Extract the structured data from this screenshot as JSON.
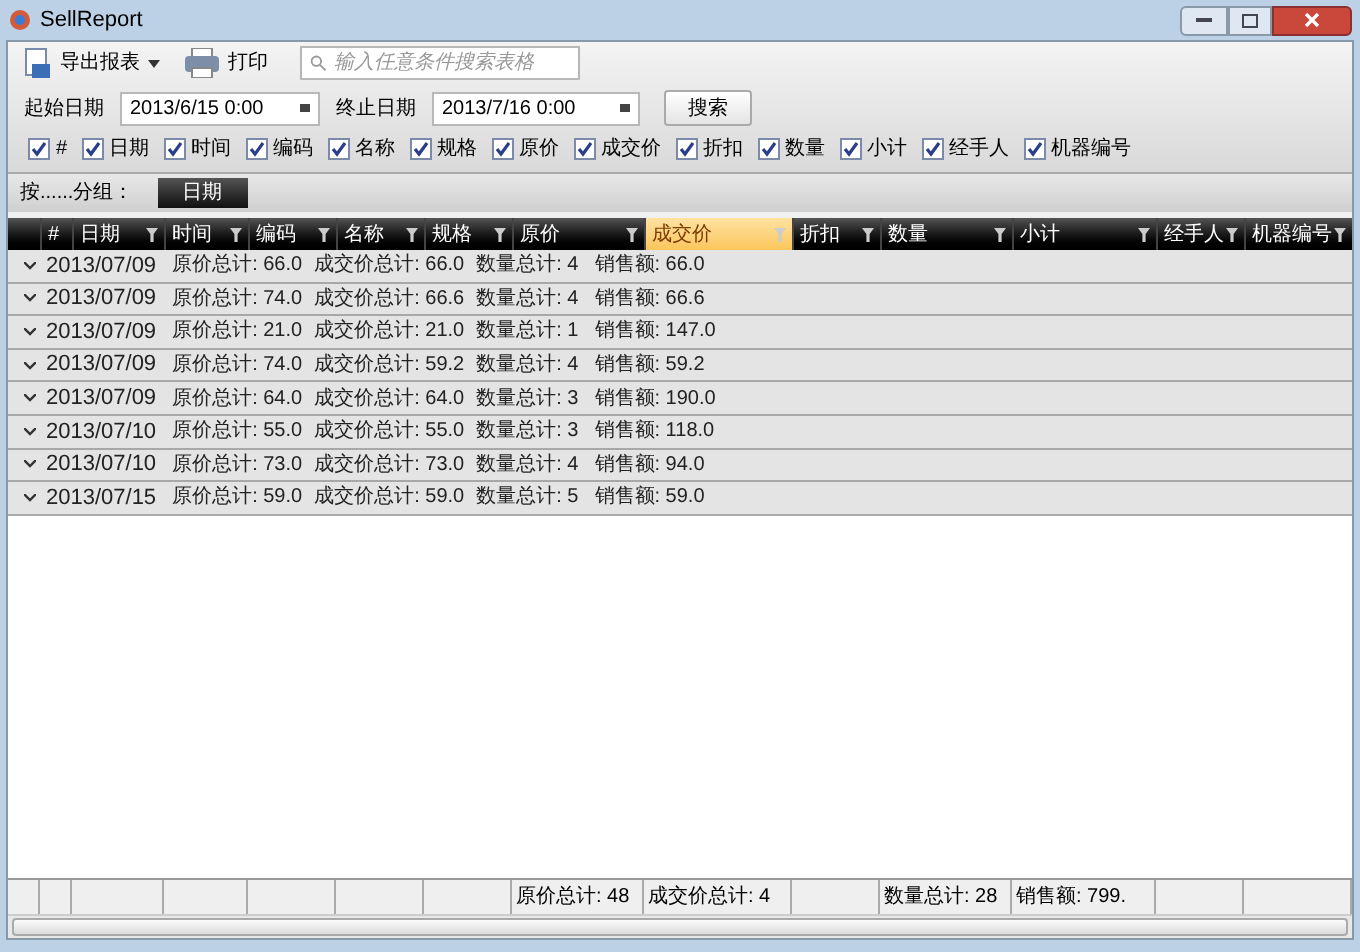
{
  "window": {
    "title": "SellReport"
  },
  "toolbar": {
    "export": "导出报表",
    "print": "打印",
    "search_placeholder": "输入任意条件搜索表格"
  },
  "filters": {
    "start_label": "起始日期",
    "start_value": "2013/6/15 0:00",
    "end_label": "终止日期",
    "end_value": "2013/7/16 0:00",
    "search_button": "搜索"
  },
  "column_toggles": [
    {
      "label": "#",
      "checked": true
    },
    {
      "label": "日期",
      "checked": true
    },
    {
      "label": "时间",
      "checked": true
    },
    {
      "label": "编码",
      "checked": true
    },
    {
      "label": "名称",
      "checked": true
    },
    {
      "label": "规格",
      "checked": true
    },
    {
      "label": "原价",
      "checked": true
    },
    {
      "label": "成交价",
      "checked": true
    },
    {
      "label": "折扣",
      "checked": true
    },
    {
      "label": "数量",
      "checked": true
    },
    {
      "label": "小计",
      "checked": true
    },
    {
      "label": "经手人",
      "checked": true
    },
    {
      "label": "机器编号",
      "checked": true
    }
  ],
  "grouping": {
    "label": "按......分组：",
    "groups": [
      "日期"
    ]
  },
  "table": {
    "columns": [
      {
        "label": "#",
        "highlighted": false
      },
      {
        "label": "日期",
        "highlighted": false
      },
      {
        "label": "时间",
        "highlighted": false
      },
      {
        "label": "编码",
        "highlighted": false
      },
      {
        "label": "名称",
        "highlighted": false
      },
      {
        "label": "规格",
        "highlighted": false
      },
      {
        "label": "原价",
        "highlighted": false
      },
      {
        "label": "成交价",
        "highlighted": true
      },
      {
        "label": "折扣",
        "highlighted": false
      },
      {
        "label": "数量",
        "highlighted": false
      },
      {
        "label": "小计",
        "highlighted": false
      },
      {
        "label": "经手人",
        "highlighted": false
      },
      {
        "label": "机器编号",
        "highlighted": false
      }
    ],
    "groups": [
      {
        "date": "2013/07/09",
        "price_total": "原价总计: 66.0",
        "deal_total": "成交价总计: 66.0",
        "qty_total": "数量总计: 4",
        "sales": "销售额: 66.0"
      },
      {
        "date": "2013/07/09",
        "price_total": "原价总计: 74.0",
        "deal_total": "成交价总计: 66.6",
        "qty_total": "数量总计: 4",
        "sales": "销售额: 66.6"
      },
      {
        "date": "2013/07/09",
        "price_total": "原价总计: 21.0",
        "deal_total": "成交价总计: 21.0",
        "qty_total": "数量总计: 1",
        "sales": "销售额: 147.0"
      },
      {
        "date": "2013/07/09",
        "price_total": "原价总计: 74.0",
        "deal_total": "成交价总计: 59.2",
        "qty_total": "数量总计: 4",
        "sales": "销售额: 59.2"
      },
      {
        "date": "2013/07/09",
        "price_total": "原价总计: 64.0",
        "deal_total": "成交价总计: 64.0",
        "qty_total": "数量总计: 3",
        "sales": "销售额: 190.0"
      },
      {
        "date": "2013/07/10",
        "price_total": "原价总计: 55.0",
        "deal_total": "成交价总计: 55.0",
        "qty_total": "数量总计: 3",
        "sales": "销售额: 118.0"
      },
      {
        "date": "2013/07/10",
        "price_total": "原价总计: 73.0",
        "deal_total": "成交价总计: 73.0",
        "qty_total": "数量总计: 4",
        "sales": "销售额: 94.0"
      },
      {
        "date": "2013/07/15",
        "price_total": "原价总计: 59.0",
        "deal_total": "成交价总计: 59.0",
        "qty_total": "数量总计: 5",
        "sales": "销售额: 59.0"
      }
    ],
    "footer": {
      "price_total": "原价总计: 48",
      "deal_total": "成交价总计: 4",
      "qty_total": "数量总计: 28",
      "sales": "销售额: 799."
    }
  }
}
